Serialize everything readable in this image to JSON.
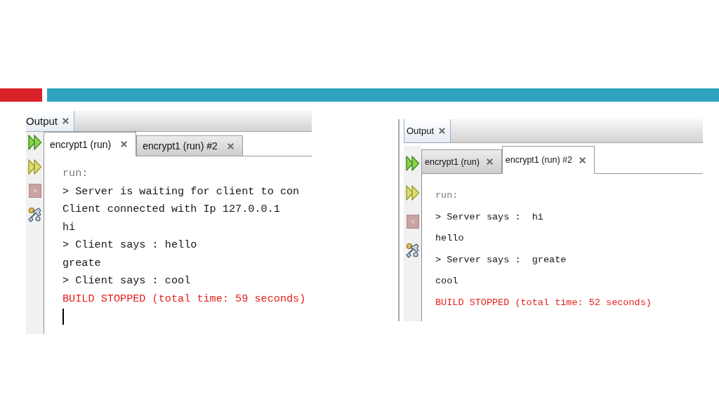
{
  "panels": [
    {
      "title": "Output",
      "tabs": [
        {
          "label": "encrypt1 (run)",
          "selected": true
        },
        {
          "label": "encrypt1 (run) #2",
          "selected": false
        }
      ],
      "lines": [
        {
          "text": "run:",
          "kind": "info"
        },
        {
          "text": "> Server is waiting for client to con",
          "kind": "output"
        },
        {
          "text": "Client connected with Ip 127.0.0.1",
          "kind": "output"
        },
        {
          "text": "hi",
          "kind": "output"
        },
        {
          "text": "> Client says : hello",
          "kind": "output"
        },
        {
          "text": "greate",
          "kind": "output"
        },
        {
          "text": "> Client says : cool",
          "kind": "output"
        },
        {
          "text": "BUILD STOPPED (total time: 59 seconds)",
          "kind": "error"
        }
      ],
      "cursor": true
    },
    {
      "title": "Output",
      "tabs": [
        {
          "label": "encrypt1 (run)",
          "selected": false
        },
        {
          "label": "encrypt1 (run) #2",
          "selected": true
        }
      ],
      "lines": [
        {
          "text": "run:",
          "kind": "info"
        },
        {
          "text": "> Server says :  hi",
          "kind": "output"
        },
        {
          "text": "hello",
          "kind": "output"
        },
        {
          "text": "> Server says :  greate",
          "kind": "output"
        },
        {
          "text": "cool",
          "kind": "output"
        },
        {
          "text": "BUILD STOPPED (total time: 52 seconds)",
          "kind": "error"
        }
      ],
      "cursor": false
    }
  ]
}
